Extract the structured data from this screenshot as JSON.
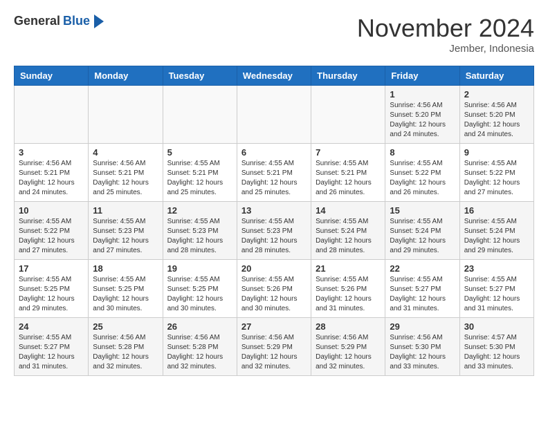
{
  "header": {
    "logo_general": "General",
    "logo_blue": "Blue",
    "month_title": "November 2024",
    "location": "Jember, Indonesia"
  },
  "calendar": {
    "days_of_week": [
      "Sunday",
      "Monday",
      "Tuesday",
      "Wednesday",
      "Thursday",
      "Friday",
      "Saturday"
    ],
    "weeks": [
      [
        {
          "day": "",
          "info": ""
        },
        {
          "day": "",
          "info": ""
        },
        {
          "day": "",
          "info": ""
        },
        {
          "day": "",
          "info": ""
        },
        {
          "day": "",
          "info": ""
        },
        {
          "day": "1",
          "info": "Sunrise: 4:56 AM\nSunset: 5:20 PM\nDaylight: 12 hours\nand 24 minutes."
        },
        {
          "day": "2",
          "info": "Sunrise: 4:56 AM\nSunset: 5:20 PM\nDaylight: 12 hours\nand 24 minutes."
        }
      ],
      [
        {
          "day": "3",
          "info": "Sunrise: 4:56 AM\nSunset: 5:21 PM\nDaylight: 12 hours\nand 24 minutes."
        },
        {
          "day": "4",
          "info": "Sunrise: 4:56 AM\nSunset: 5:21 PM\nDaylight: 12 hours\nand 25 minutes."
        },
        {
          "day": "5",
          "info": "Sunrise: 4:55 AM\nSunset: 5:21 PM\nDaylight: 12 hours\nand 25 minutes."
        },
        {
          "day": "6",
          "info": "Sunrise: 4:55 AM\nSunset: 5:21 PM\nDaylight: 12 hours\nand 25 minutes."
        },
        {
          "day": "7",
          "info": "Sunrise: 4:55 AM\nSunset: 5:21 PM\nDaylight: 12 hours\nand 26 minutes."
        },
        {
          "day": "8",
          "info": "Sunrise: 4:55 AM\nSunset: 5:22 PM\nDaylight: 12 hours\nand 26 minutes."
        },
        {
          "day": "9",
          "info": "Sunrise: 4:55 AM\nSunset: 5:22 PM\nDaylight: 12 hours\nand 27 minutes."
        }
      ],
      [
        {
          "day": "10",
          "info": "Sunrise: 4:55 AM\nSunset: 5:22 PM\nDaylight: 12 hours\nand 27 minutes."
        },
        {
          "day": "11",
          "info": "Sunrise: 4:55 AM\nSunset: 5:23 PM\nDaylight: 12 hours\nand 27 minutes."
        },
        {
          "day": "12",
          "info": "Sunrise: 4:55 AM\nSunset: 5:23 PM\nDaylight: 12 hours\nand 28 minutes."
        },
        {
          "day": "13",
          "info": "Sunrise: 4:55 AM\nSunset: 5:23 PM\nDaylight: 12 hours\nand 28 minutes."
        },
        {
          "day": "14",
          "info": "Sunrise: 4:55 AM\nSunset: 5:24 PM\nDaylight: 12 hours\nand 28 minutes."
        },
        {
          "day": "15",
          "info": "Sunrise: 4:55 AM\nSunset: 5:24 PM\nDaylight: 12 hours\nand 29 minutes."
        },
        {
          "day": "16",
          "info": "Sunrise: 4:55 AM\nSunset: 5:24 PM\nDaylight: 12 hours\nand 29 minutes."
        }
      ],
      [
        {
          "day": "17",
          "info": "Sunrise: 4:55 AM\nSunset: 5:25 PM\nDaylight: 12 hours\nand 29 minutes."
        },
        {
          "day": "18",
          "info": "Sunrise: 4:55 AM\nSunset: 5:25 PM\nDaylight: 12 hours\nand 30 minutes."
        },
        {
          "day": "19",
          "info": "Sunrise: 4:55 AM\nSunset: 5:25 PM\nDaylight: 12 hours\nand 30 minutes."
        },
        {
          "day": "20",
          "info": "Sunrise: 4:55 AM\nSunset: 5:26 PM\nDaylight: 12 hours\nand 30 minutes."
        },
        {
          "day": "21",
          "info": "Sunrise: 4:55 AM\nSunset: 5:26 PM\nDaylight: 12 hours\nand 31 minutes."
        },
        {
          "day": "22",
          "info": "Sunrise: 4:55 AM\nSunset: 5:27 PM\nDaylight: 12 hours\nand 31 minutes."
        },
        {
          "day": "23",
          "info": "Sunrise: 4:55 AM\nSunset: 5:27 PM\nDaylight: 12 hours\nand 31 minutes."
        }
      ],
      [
        {
          "day": "24",
          "info": "Sunrise: 4:55 AM\nSunset: 5:27 PM\nDaylight: 12 hours\nand 31 minutes."
        },
        {
          "day": "25",
          "info": "Sunrise: 4:56 AM\nSunset: 5:28 PM\nDaylight: 12 hours\nand 32 minutes."
        },
        {
          "day": "26",
          "info": "Sunrise: 4:56 AM\nSunset: 5:28 PM\nDaylight: 12 hours\nand 32 minutes."
        },
        {
          "day": "27",
          "info": "Sunrise: 4:56 AM\nSunset: 5:29 PM\nDaylight: 12 hours\nand 32 minutes."
        },
        {
          "day": "28",
          "info": "Sunrise: 4:56 AM\nSunset: 5:29 PM\nDaylight: 12 hours\nand 32 minutes."
        },
        {
          "day": "29",
          "info": "Sunrise: 4:56 AM\nSunset: 5:30 PM\nDaylight: 12 hours\nand 33 minutes."
        },
        {
          "day": "30",
          "info": "Sunrise: 4:57 AM\nSunset: 5:30 PM\nDaylight: 12 hours\nand 33 minutes."
        }
      ]
    ]
  }
}
